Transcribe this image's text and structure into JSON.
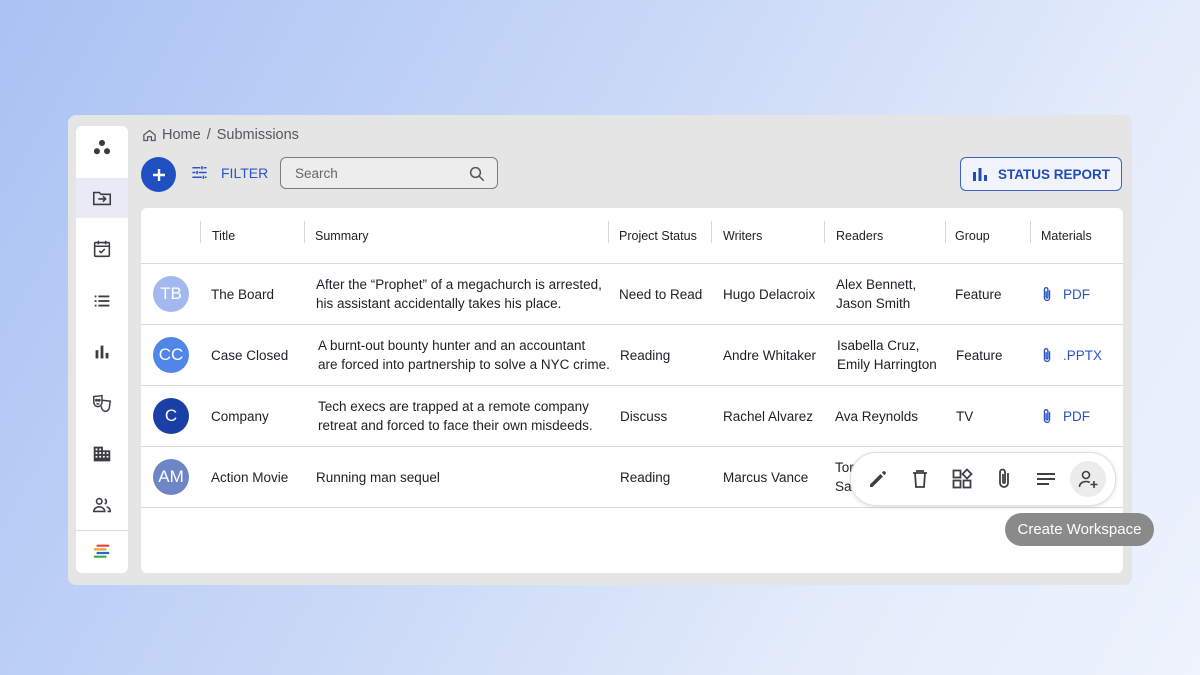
{
  "breadcrumb": {
    "home": "Home",
    "separator": "/",
    "current": "Submissions"
  },
  "toolbar": {
    "add_icon": "plus-icon",
    "filter_label": "FILTER",
    "search_placeholder": "Search",
    "status_report_label": "STATUS REPORT"
  },
  "sidebar": {
    "items": [
      {
        "icon": "app-logo-icon"
      },
      {
        "icon": "folder-import-icon",
        "active": true
      },
      {
        "icon": "calendar-check-icon"
      },
      {
        "icon": "list-icon"
      },
      {
        "icon": "bar-chart-icon"
      },
      {
        "icon": "theater-masks-icon"
      },
      {
        "icon": "building-icon"
      },
      {
        "icon": "people-icon"
      },
      {
        "icon": "brand-stripes-icon"
      }
    ]
  },
  "table": {
    "headers": [
      "Title",
      "Summary",
      "Project Status",
      "Writers",
      "Readers",
      "Group",
      "Materials"
    ],
    "rows": [
      {
        "initials": "TB",
        "avatar_color": "#a3b8ee",
        "title": "The Board",
        "summary_1": "After the “Prophet” of a megachurch is arrested,",
        "summary_2": "his assistant accidentally takes his place.",
        "status": "Need to Read",
        "writers": "Hugo Delacroix",
        "readers_1": "Alex Bennett,",
        "readers_2": "Jason Smith",
        "group": "Feature",
        "material": "PDF"
      },
      {
        "initials": "CC",
        "avatar_color": "#4f86e7",
        "title": "Case Closed",
        "summary_1": "A burnt-out bounty hunter and an accountant",
        "summary_2": "are forced into partnership to solve a NYC crime.",
        "status": "Reading",
        "writers": "Andre Whitaker",
        "readers_1": "Isabella Cruz,",
        "readers_2": "Emily Harrington",
        "group": "Feature",
        "material": ".PPTX"
      },
      {
        "initials": "C",
        "avatar_color": "#1a3fa6",
        "title": "Company",
        "summary_1": "Tech execs are trapped at a remote company",
        "summary_2": "retreat and forced to face their own misdeeds.",
        "status": "Discuss",
        "writers": "Rachel Alvarez",
        "readers_1": "Ava Reynolds",
        "readers_2": "",
        "group": "TV",
        "material": "PDF"
      },
      {
        "initials": "AM",
        "avatar_color": "#6e86c5",
        "title": "Action Movie",
        "summary_1": "Running man sequel",
        "summary_2": "",
        "status": "Reading",
        "writers": "Marcus Vance",
        "readers_1": "Tor",
        "readers_2": "Sa",
        "group": "",
        "material": ""
      }
    ]
  },
  "row_actions": {
    "icons": [
      "edit-icon",
      "delete-icon",
      "workspace-icon",
      "attach-icon",
      "notes-icon",
      "add-person-icon"
    ],
    "tooltip": "Create Workspace"
  },
  "colors": {
    "primary": "#1f4fc1",
    "link": "#2a54c4"
  }
}
